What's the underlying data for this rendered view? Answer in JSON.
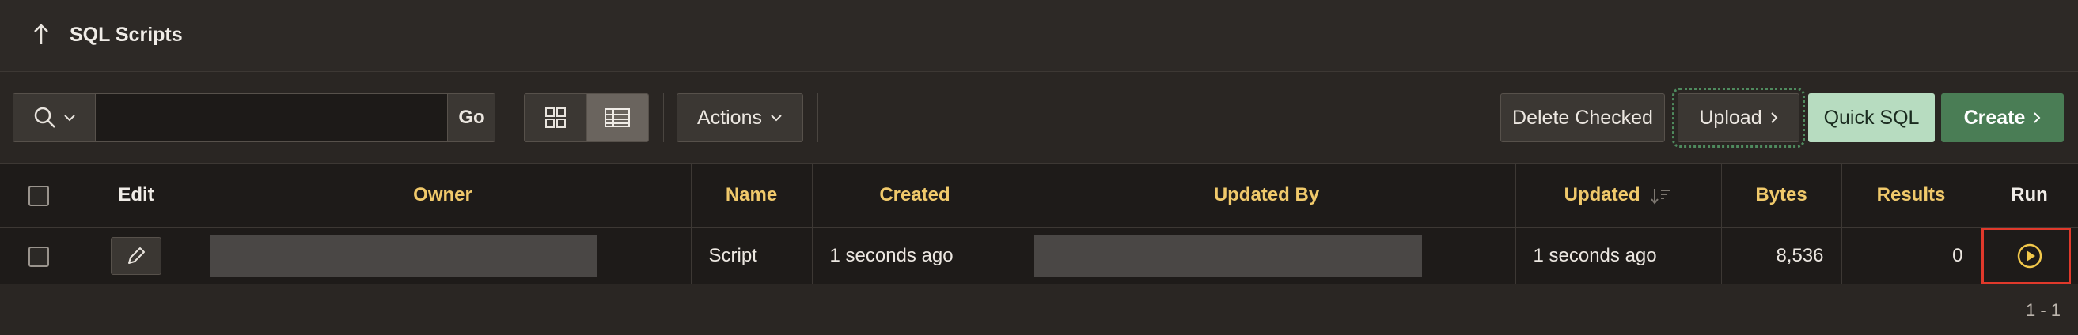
{
  "page": {
    "title": "SQL Scripts",
    "up_icon": "arrow-up-icon"
  },
  "toolbar": {
    "search_placeholder": "",
    "search_value": "",
    "go_label": "Go",
    "actions_label": "Actions",
    "delete_checked_label": "Delete Checked",
    "upload_label": "Upload",
    "quick_sql_label": "Quick SQL",
    "create_label": "Create",
    "views": [
      "grid-view-icon",
      "table-view-icon"
    ],
    "active_view": "table-view-icon"
  },
  "table": {
    "columns": [
      "Edit",
      "Owner",
      "Name",
      "Created",
      "Updated By",
      "Updated",
      "Bytes",
      "Results",
      "Run"
    ],
    "rows": [
      {
        "owner": "",
        "name": "Script",
        "created": "1 seconds ago",
        "updated_by": "",
        "updated": "1 seconds ago",
        "bytes": "8,536",
        "results": "0"
      }
    ],
    "sort_column": "Updated",
    "sort_direction": "descending"
  },
  "footer": {
    "pagination": "1 - 1"
  },
  "colors": {
    "accent_header": "#f0c96b",
    "create_button": "#4a7d55",
    "quick_sql_button": "#b7dcc0",
    "run_highlight": "#e0392b",
    "run_icon": "#f2c84b"
  }
}
